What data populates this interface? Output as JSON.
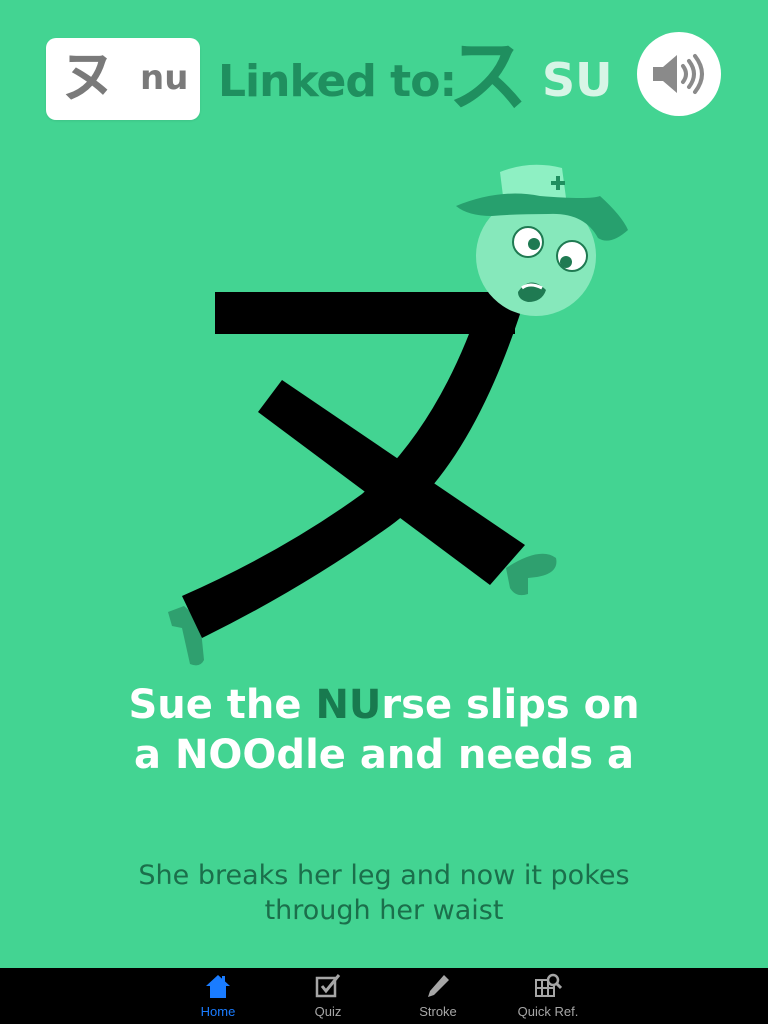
{
  "header": {
    "current_kana": "ヌ",
    "current_romaji": "nu",
    "linked_label": "Linked to:",
    "linked_kana": "ス",
    "linked_romaji": "SU"
  },
  "mnemonic": {
    "part1": "Sue the ",
    "highlight": "NU",
    "part2": "rse slips on",
    "line2": "a NOOdle and needs a"
  },
  "explanation": {
    "line1": "She breaks her leg and now it pokes",
    "line2": "through her waist"
  },
  "tabs": [
    {
      "label": "Home",
      "icon": "home-icon",
      "active": true
    },
    {
      "label": "Quiz",
      "icon": "quiz-checkbox-icon",
      "active": false
    },
    {
      "label": "Stroke",
      "icon": "pencil-icon",
      "active": false
    },
    {
      "label": "Quick Ref.",
      "icon": "grid-search-icon",
      "active": false
    }
  ],
  "colors": {
    "background": "#43d492",
    "accent_dark": "#1f8f5f",
    "tab_active": "#1a7cff",
    "tab_inactive": "#a6a6a6"
  }
}
